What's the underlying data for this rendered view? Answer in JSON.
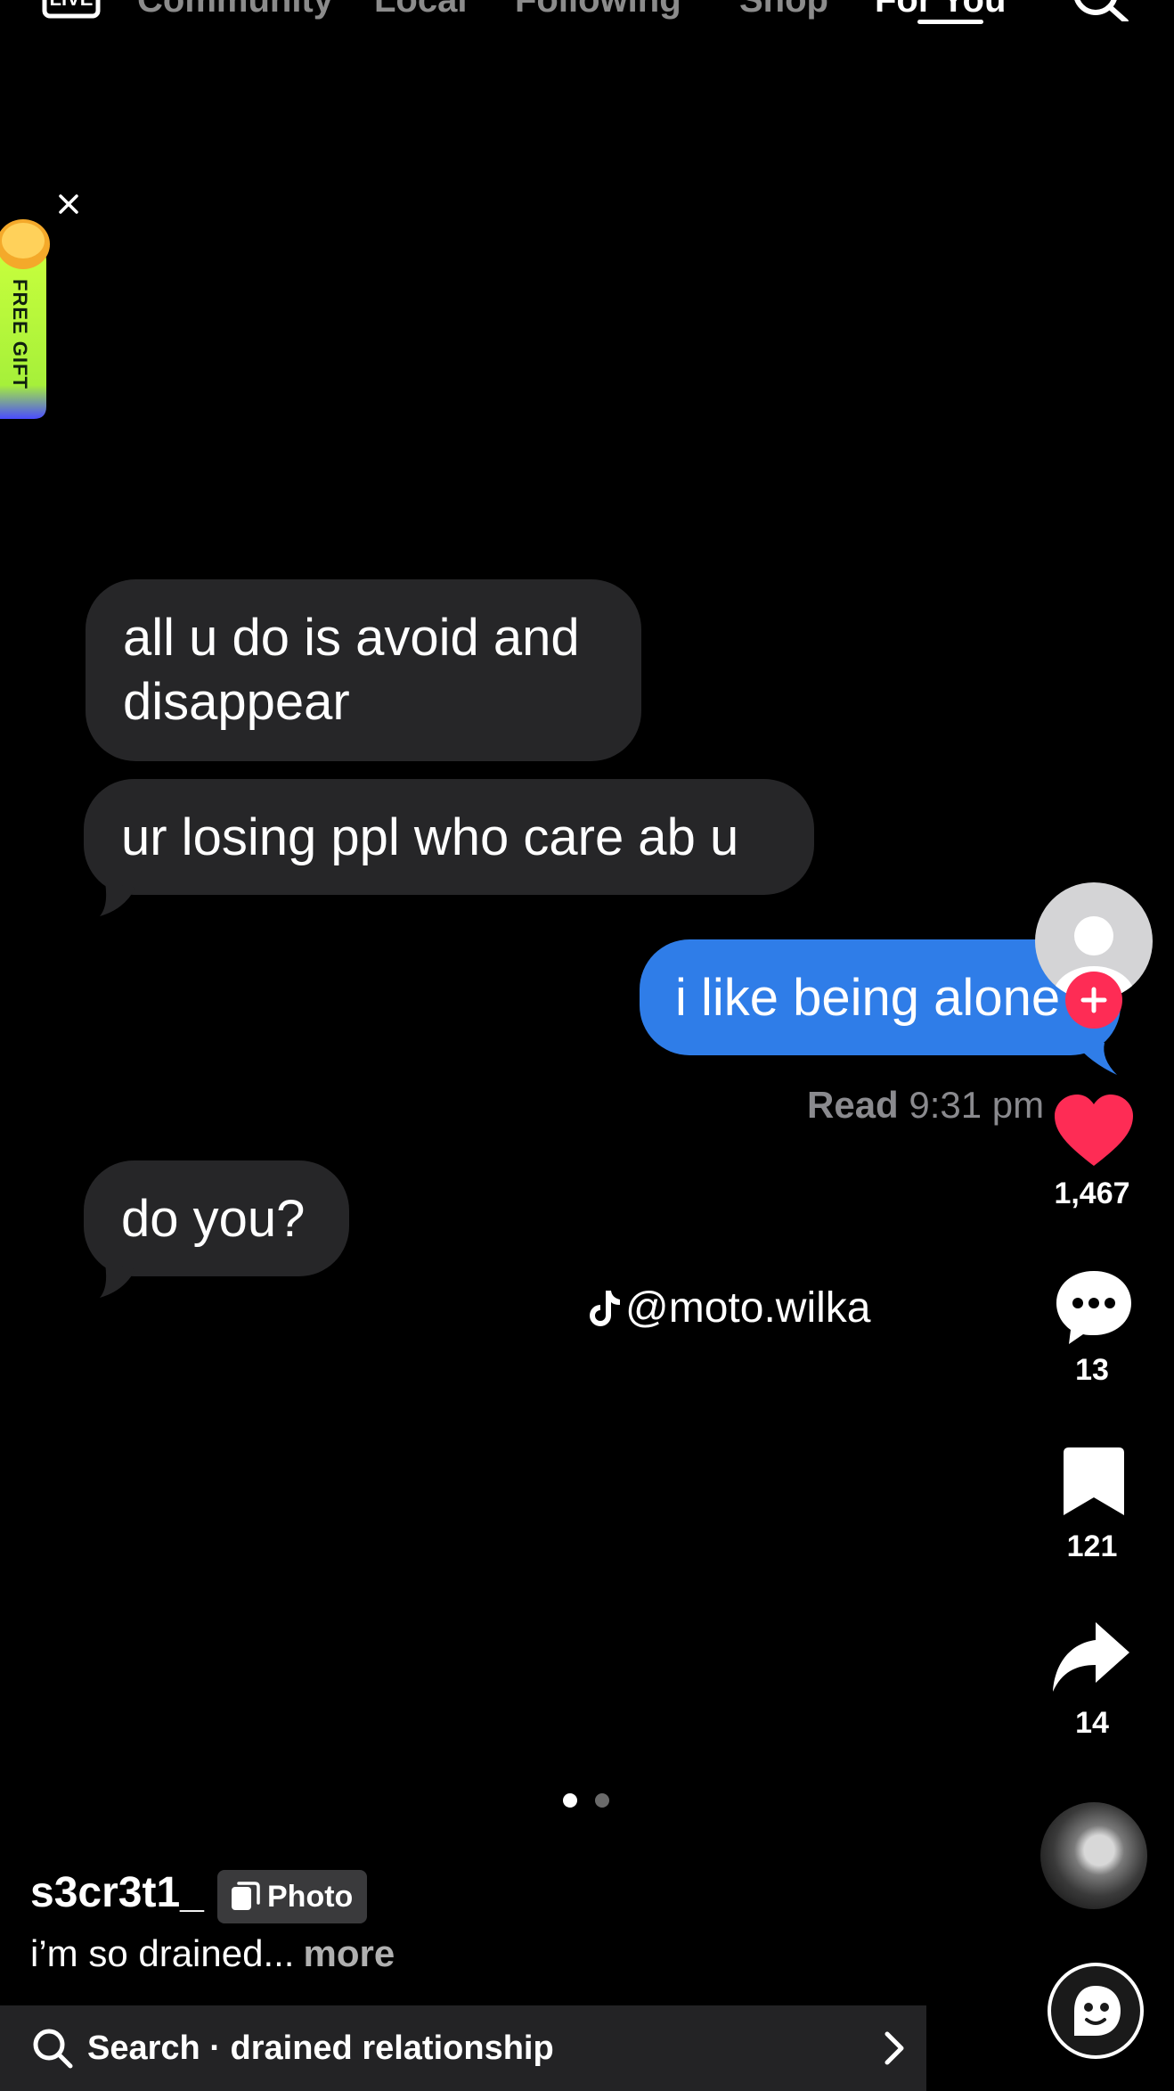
{
  "nav": {
    "tabs": [
      {
        "label": "Community",
        "active": false
      },
      {
        "label": "Local",
        "active": false
      },
      {
        "label": "Following",
        "active": false
      },
      {
        "label": "Shop",
        "active": false
      },
      {
        "label": "For You",
        "active": true
      }
    ],
    "live_icon": "live-tv-icon",
    "search_icon": "search-icon"
  },
  "free_gift": {
    "label": "FREE GIFT",
    "close_icon": "close-icon"
  },
  "chat": {
    "messages": [
      {
        "side": "received",
        "text": "all u do is avoid and disappear"
      },
      {
        "side": "received",
        "text": "ur losing ppl who care ab u"
      },
      {
        "side": "sent",
        "text": "i like being alone"
      },
      {
        "side": "received",
        "text": "do you?"
      }
    ],
    "read_label": "Read",
    "read_time": "9:31 pm",
    "watermark": "@moto.wilka"
  },
  "rail": {
    "likes": "1,467",
    "comments": "13",
    "saves": "121",
    "shares": "14"
  },
  "pagination": {
    "total": 2,
    "current": 1
  },
  "post": {
    "username": "s3cr3t1_",
    "badge": "Photo",
    "caption": "i’m so drained...",
    "more_label": "more"
  },
  "search": {
    "text": "Search · drained relationship"
  },
  "colors": {
    "like": "#fe2c55",
    "sent_bubble": "#2f7de8",
    "received_bubble": "#262628"
  }
}
